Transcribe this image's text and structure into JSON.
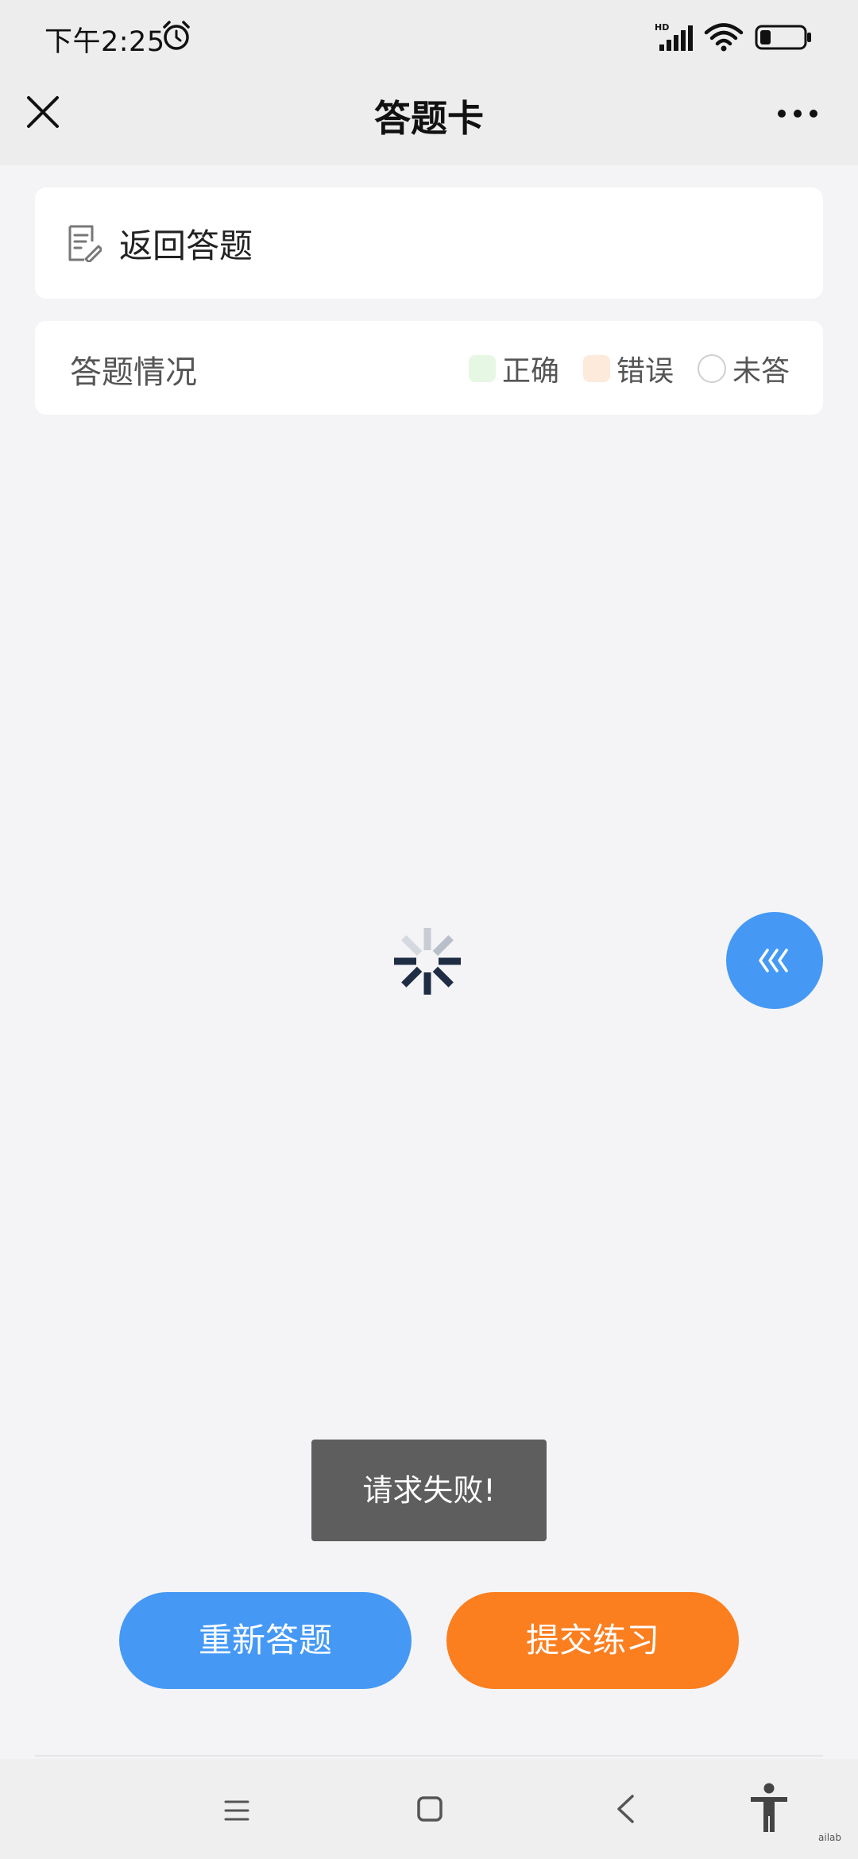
{
  "status_bar": {
    "time": "下午2:25",
    "icons": [
      "alarm-icon",
      "hd-signal-icon",
      "wifi-icon",
      "battery-icon"
    ]
  },
  "header": {
    "title": "答题卡",
    "left_icon": "close-icon",
    "right_icon": "more-icon"
  },
  "back_card": {
    "icon": "document-edit-icon",
    "label": "返回答题"
  },
  "status_card": {
    "label": "答题情况",
    "legend": [
      {
        "label": "正确",
        "color": "#e6f7e4"
      },
      {
        "label": "错误",
        "color": "#fdeadb"
      },
      {
        "label": "未答",
        "color": "#ffffff"
      }
    ]
  },
  "loading": {
    "icon": "loading-spinner-icon"
  },
  "floating_button": {
    "icon": "triple-chevron-left-icon",
    "color": "#4599f5"
  },
  "toast": {
    "message": "请求失败!"
  },
  "actions": {
    "redo_label": "重新答题",
    "redo_color": "#4599f5",
    "submit_label": "提交练习",
    "submit_color": "#fb7e1f"
  },
  "nav_bar": {
    "icons": [
      "menu-icon",
      "home-icon",
      "back-icon",
      "accessibility-icon"
    ],
    "watermark": "ailab"
  }
}
